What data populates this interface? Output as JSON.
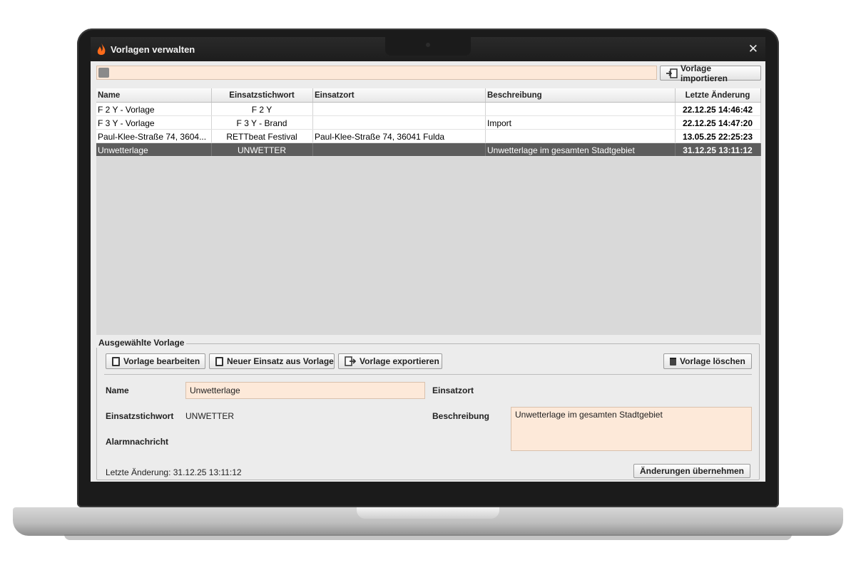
{
  "window": {
    "title": "Vorlagen verwalten",
    "close": "✕"
  },
  "search": {
    "value": "",
    "placeholder": ""
  },
  "toolbar": {
    "import_label": "Vorlage importieren"
  },
  "table": {
    "columns": [
      "Name",
      "Einsatzstichwort",
      "Einsatzort",
      "Beschreibung",
      "Letzte Änderung"
    ],
    "rows": [
      {
        "name": "F 2 Y - Vorlage",
        "stichwort": "F 2 Y",
        "ort": "",
        "beschreibung": "",
        "geaendert": "22.12.25 14:46:42"
      },
      {
        "name": "F 3 Y - Vorlage",
        "stichwort": "F 3 Y - Brand",
        "ort": "",
        "beschreibung": "Import",
        "geaendert": "22.12.25 14:47:20"
      },
      {
        "name": "Paul-Klee-Straße 74, 3604...",
        "stichwort": "RETTbeat Festival",
        "ort": "Paul-Klee-Straße 74, 36041 Fulda",
        "beschreibung": "",
        "geaendert": "13.05.25 22:25:23"
      },
      {
        "name": "Unwetterlage",
        "stichwort": "UNWETTER",
        "ort": "",
        "beschreibung": "Unwetterlage im gesamten Stadtgebiet",
        "geaendert": "31.12.25 13:11:12"
      }
    ],
    "selected_index": 3
  },
  "panel": {
    "legend": "Ausgewählte Vorlage",
    "buttons": {
      "edit": "Vorlage bearbeiten",
      "new_incident": "Neuer Einsatz aus Vorlage",
      "export": "Vorlage exportieren",
      "delete": "Vorlage löschen",
      "apply": "Änderungen übernehmen"
    },
    "labels": {
      "name": "Name",
      "stichwort": "Einsatzstichwort",
      "alarm": "Alarmnachricht",
      "ort": "Einsatzort",
      "beschreibung": "Beschreibung"
    },
    "values": {
      "name": "Unwetterlage",
      "stichwort": "UNWETTER",
      "beschreibung": "Unwetterlage im gesamten Stadtgebiet",
      "last_change": "Letzte Änderung: 31.12.25 13:11:12"
    }
  },
  "colors": {
    "input_bg": "#fde9d9",
    "selected_row": "#5d5d5d",
    "titlebar": "#1d1d1d"
  }
}
